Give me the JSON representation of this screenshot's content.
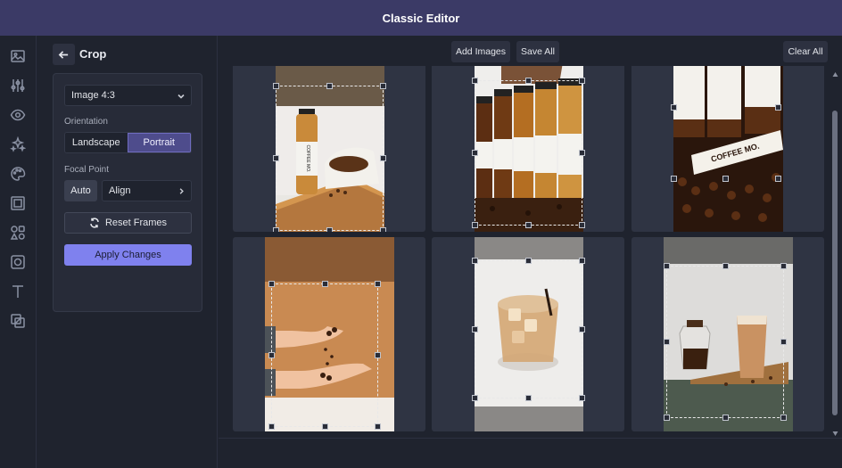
{
  "app": {
    "title": "Classic Editor"
  },
  "rail": {
    "icons": [
      "image-icon",
      "sliders-icon",
      "eye-icon",
      "sparkle-icon",
      "palette-icon",
      "frame-icon",
      "shapes-icon",
      "focus-frame-icon",
      "text-icon",
      "layers-icon"
    ]
  },
  "panel": {
    "title": "Crop",
    "aspect_select": "Image 4:3",
    "orientation_label": "Orientation",
    "orientation_options": [
      "Landscape",
      "Portrait"
    ],
    "orientation_selected": "Portrait",
    "focal_label": "Focal Point",
    "focal_auto": "Auto",
    "focal_align": "Align",
    "reset_label": "Reset Frames",
    "apply_label": "Apply Changes"
  },
  "toolbar": {
    "add_images": "Add Images",
    "save_all": "Save All",
    "clear_all": "Clear All"
  },
  "images": [
    {
      "name": "coffee-bottle-with-beans-sack"
    },
    {
      "name": "row-of-coffee-bottles"
    },
    {
      "name": "coffee-mo-bottles-on-beans"
    },
    {
      "name": "beans-falling-into-hands"
    },
    {
      "name": "iced-coffee-glass"
    },
    {
      "name": "iced-coffee-with-carafe"
    }
  ],
  "bottle_label": "COFFEE MO.",
  "colors": {
    "topbar": "#3b3a66",
    "accent": "#7f81ee",
    "active_segment": "#4e4c8c",
    "tile": "#2f3443"
  }
}
